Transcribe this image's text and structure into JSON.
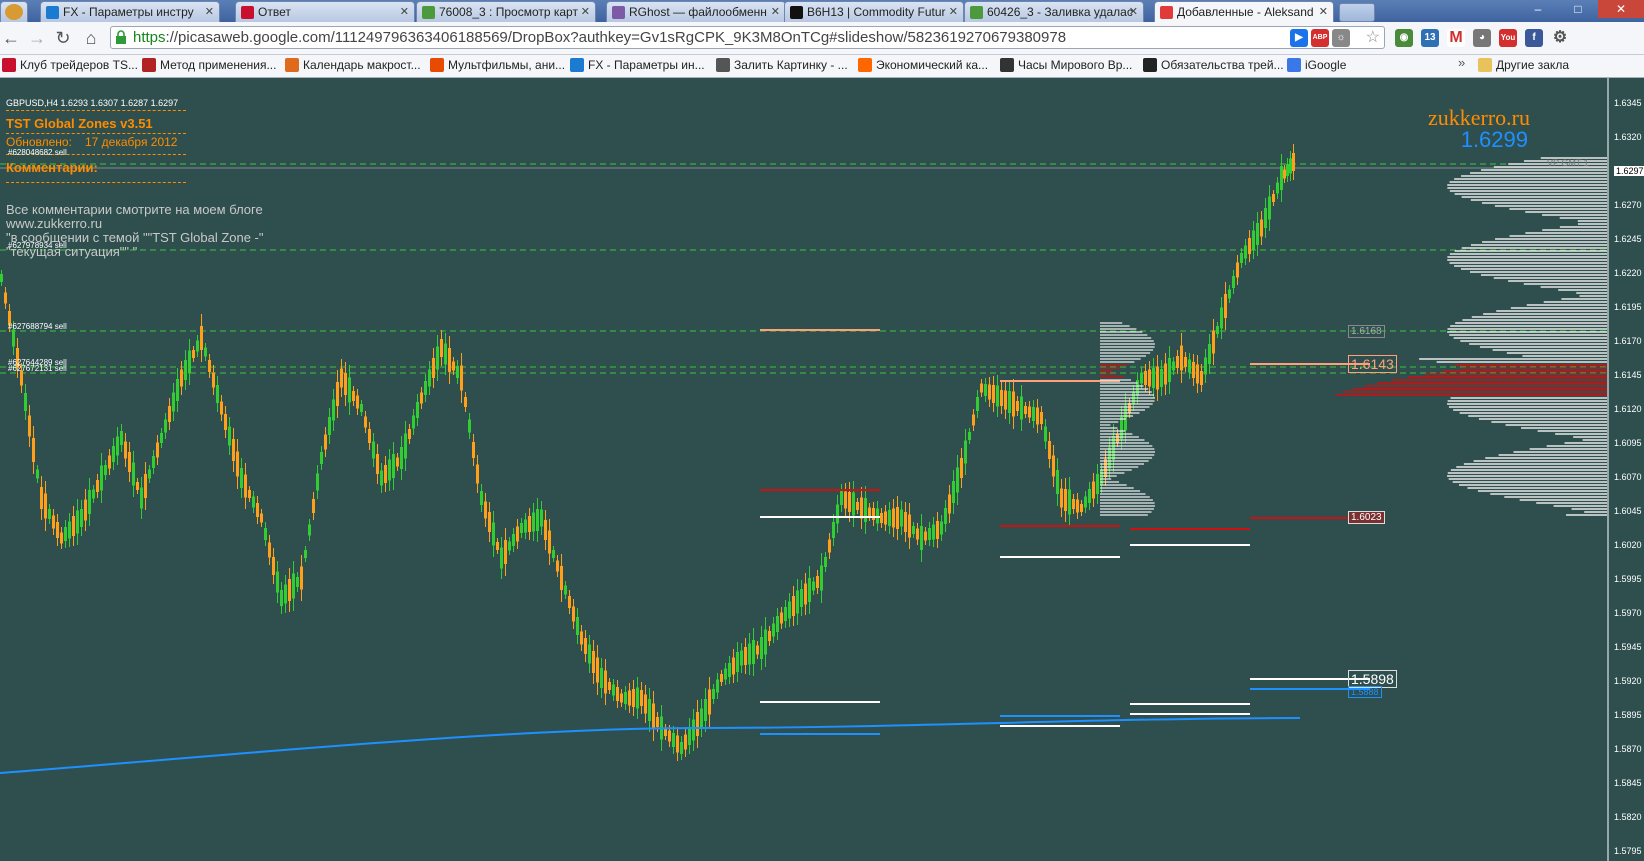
{
  "tabs": [
    {
      "label": "FX - Параметры инстру",
      "icon": "globe-icon",
      "color": "#1a7bd1"
    },
    {
      "label": "Ответ",
      "icon": "tst-icon",
      "color": "#c8102e"
    },
    {
      "label": "76008_3 : Просмотр карт",
      "icon": "image-icon",
      "color": "#4c9a3d"
    },
    {
      "label": "RGhost — файлообменн",
      "icon": "ghost-icon",
      "color": "#7c5aa6"
    },
    {
      "label": "B6H13 | Commodity Futur",
      "icon": "b-icon",
      "color": "#111"
    },
    {
      "label": "60426_3 - Заливка удалас",
      "icon": "image-icon",
      "color": "#4c9a3d"
    },
    {
      "label": "Добавленные - Aleksand",
      "icon": "picasa-icon",
      "color": "#e03a3a",
      "active": true
    }
  ],
  "address": {
    "scheme": "https",
    "rest": "://picasaweb.google.com/111249796363406188569/DropBox?authkey=Gv1sRgCPK_9K3M8OnTCg#slideshow/5823619270679380978"
  },
  "bookmarks": [
    {
      "label": "Клуб трейдеров TS...",
      "color": "#c8102e"
    },
    {
      "label": "Метод применения...",
      "color": "#b22222"
    },
    {
      "label": "Календарь макрост...",
      "color": "#e06a1b"
    },
    {
      "label": "Мультфильмы, ани...",
      "color": "#e84a00"
    },
    {
      "label": "FX - Параметры ин...",
      "color": "#1a7bd1"
    },
    {
      "label": "Залить Картинку - ...",
      "color": "#555555"
    },
    {
      "label": "Экономический ка...",
      "color": "#ff6600"
    },
    {
      "label": "Часы Мирового Вр...",
      "color": "#333333"
    },
    {
      "label": "Обязательства трей...",
      "color": "#222222"
    },
    {
      "label": "iGoogle",
      "color": "#3b78e7"
    }
  ],
  "bookmarks_other": "Другие закла",
  "chart": {
    "symbol_line": "GBPUSD,H4  1.6293 1.6307 1.6287 1.6297",
    "indicator_title": "TST Global Zones  v3.51",
    "updated_label": "Обновлено:",
    "updated_date": "17 декабря 2012",
    "comments_label": "Комментарии:",
    "comment_lines": [
      "Все комментарии смотрите на моем блоге",
      "www.zukkerro.ru",
      "\"в сообщении с темой \"\"TST Global Zone -\"",
      "\"текущая ситуация\"\" \""
    ],
    "order_labels": [
      "#628048682 sell",
      "#627978934 sell",
      "#627688794 sell",
      "#627644289 sell",
      "#627672131 sell"
    ],
    "brand": "zukkerro.ru",
    "big_price": "1.6299",
    "vp_label": "VP GMT 1",
    "zone_prices": [
      "1.6168",
      "1.6143",
      "1.6023",
      "1.5898",
      "1.5888"
    ],
    "price_axis": [
      "1.6345",
      "1.6320",
      "1.6297",
      "1.6270",
      "1.6245",
      "1.6220",
      "1.6195",
      "1.6170",
      "1.6145",
      "1.6120",
      "1.6095",
      "1.6070",
      "1.6045",
      "1.6020",
      "1.5995",
      "1.5970",
      "1.5945",
      "1.5920",
      "1.5895",
      "1.5870",
      "1.5845",
      "1.5820",
      "1.5795"
    ]
  },
  "colors": {
    "bg": "#2f4f4f",
    "bull": "#32cd32",
    "bear": "#ff9f1a",
    "ma": "#1e90ff",
    "zone_red": "#cc1111",
    "zone_salmon": "#ffa07a"
  }
}
